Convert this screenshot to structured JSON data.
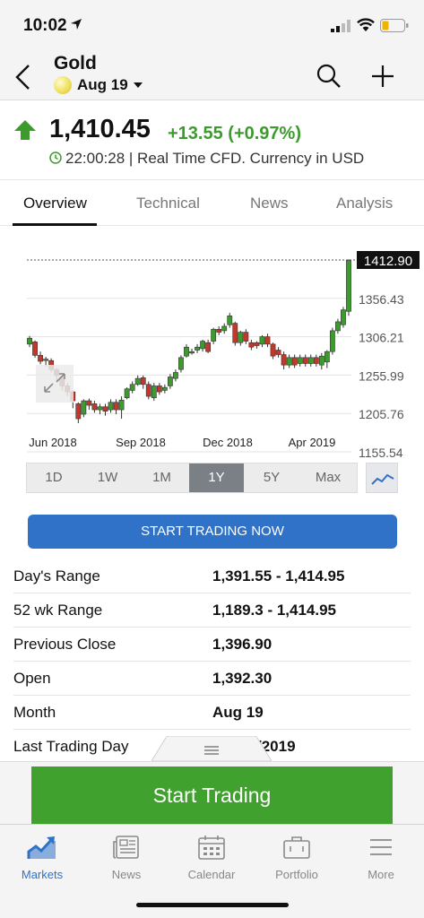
{
  "status": {
    "time": "10:02"
  },
  "header": {
    "title": "Gold",
    "contract": "Aug 19"
  },
  "quote": {
    "price": "1,410.45",
    "change": "+13.55 (+0.97%)",
    "time_text": "22:00:28 | Real Time CFD. Currency in USD",
    "change_color": "#3d9b2e"
  },
  "tabs": [
    "Overview",
    "Technical",
    "News",
    "Analysis"
  ],
  "active_tab": "Overview",
  "chart_data": {
    "type": "candlestick",
    "x_ticks": [
      "Jun 2018",
      "Sep 2018",
      "Dec 2018",
      "Apr 2019"
    ],
    "y_ticks": [
      "1412.90",
      "1356.43",
      "1306.21",
      "1255.99",
      "1205.76",
      "1155.54"
    ],
    "last_price_label": "1412.90",
    "up_color": "#3d9b2e",
    "down_color": "#c0392b",
    "ylim": [
      1155.54,
      1412.9
    ],
    "candles": [
      {
        "o": 1300,
        "c": 1308,
        "h": 1311,
        "l": 1296
      },
      {
        "o": 1303,
        "c": 1285,
        "h": 1305,
        "l": 1282
      },
      {
        "o": 1285,
        "c": 1277,
        "h": 1290,
        "l": 1273
      },
      {
        "o": 1278,
        "c": 1280,
        "h": 1283,
        "l": 1270
      },
      {
        "o": 1278,
        "c": 1266,
        "h": 1281,
        "l": 1262
      },
      {
        "o": 1266,
        "c": 1258,
        "h": 1268,
        "l": 1250
      },
      {
        "o": 1256,
        "c": 1244,
        "h": 1258,
        "l": 1238
      },
      {
        "o": 1244,
        "c": 1236,
        "h": 1248,
        "l": 1230
      },
      {
        "o": 1236,
        "c": 1224,
        "h": 1238,
        "l": 1214
      },
      {
        "o": 1220,
        "c": 1200,
        "h": 1222,
        "l": 1194
      },
      {
        "o": 1206,
        "c": 1224,
        "h": 1226,
        "l": 1202
      },
      {
        "o": 1224,
        "c": 1218,
        "h": 1227,
        "l": 1212
      },
      {
        "o": 1220,
        "c": 1212,
        "h": 1224,
        "l": 1208
      },
      {
        "o": 1212,
        "c": 1216,
        "h": 1220,
        "l": 1206
      },
      {
        "o": 1216,
        "c": 1210,
        "h": 1220,
        "l": 1204
      },
      {
        "o": 1212,
        "c": 1222,
        "h": 1226,
        "l": 1208
      },
      {
        "o": 1222,
        "c": 1212,
        "h": 1226,
        "l": 1206
      },
      {
        "o": 1212,
        "c": 1225,
        "h": 1230,
        "l": 1200
      },
      {
        "o": 1228,
        "c": 1240,
        "h": 1242,
        "l": 1226
      },
      {
        "o": 1238,
        "c": 1246,
        "h": 1250,
        "l": 1234
      },
      {
        "o": 1246,
        "c": 1254,
        "h": 1258,
        "l": 1244
      },
      {
        "o": 1255,
        "c": 1246,
        "h": 1258,
        "l": 1240
      },
      {
        "o": 1246,
        "c": 1230,
        "h": 1250,
        "l": 1226
      },
      {
        "o": 1228,
        "c": 1244,
        "h": 1248,
        "l": 1224
      },
      {
        "o": 1244,
        "c": 1236,
        "h": 1248,
        "l": 1232
      },
      {
        "o": 1238,
        "c": 1242,
        "h": 1246,
        "l": 1234
      },
      {
        "o": 1244,
        "c": 1256,
        "h": 1260,
        "l": 1240
      },
      {
        "o": 1254,
        "c": 1262,
        "h": 1266,
        "l": 1250
      },
      {
        "o": 1266,
        "c": 1282,
        "h": 1285,
        "l": 1262
      },
      {
        "o": 1284,
        "c": 1296,
        "h": 1300,
        "l": 1282
      },
      {
        "o": 1288,
        "c": 1290,
        "h": 1294,
        "l": 1286
      },
      {
        "o": 1292,
        "c": 1296,
        "h": 1300,
        "l": 1288
      },
      {
        "o": 1294,
        "c": 1304,
        "h": 1306,
        "l": 1290
      },
      {
        "o": 1302,
        "c": 1290,
        "h": 1306,
        "l": 1288
      },
      {
        "o": 1304,
        "c": 1320,
        "h": 1322,
        "l": 1300
      },
      {
        "o": 1320,
        "c": 1316,
        "h": 1324,
        "l": 1312
      },
      {
        "o": 1318,
        "c": 1324,
        "h": 1328,
        "l": 1314
      },
      {
        "o": 1326,
        "c": 1338,
        "h": 1342,
        "l": 1322
      },
      {
        "o": 1328,
        "c": 1302,
        "h": 1330,
        "l": 1298
      },
      {
        "o": 1302,
        "c": 1316,
        "h": 1318,
        "l": 1298
      },
      {
        "o": 1316,
        "c": 1304,
        "h": 1320,
        "l": 1300
      },
      {
        "o": 1302,
        "c": 1296,
        "h": 1306,
        "l": 1292
      },
      {
        "o": 1302,
        "c": 1298,
        "h": 1304,
        "l": 1294
      },
      {
        "o": 1300,
        "c": 1310,
        "h": 1312,
        "l": 1296
      },
      {
        "o": 1310,
        "c": 1300,
        "h": 1314,
        "l": 1296
      },
      {
        "o": 1300,
        "c": 1284,
        "h": 1302,
        "l": 1280
      },
      {
        "o": 1292,
        "c": 1286,
        "h": 1296,
        "l": 1282
      },
      {
        "o": 1286,
        "c": 1272,
        "h": 1290,
        "l": 1266
      },
      {
        "o": 1272,
        "c": 1282,
        "h": 1286,
        "l": 1268
      },
      {
        "o": 1282,
        "c": 1272,
        "h": 1286,
        "l": 1268
      },
      {
        "o": 1274,
        "c": 1282,
        "h": 1286,
        "l": 1270
      },
      {
        "o": 1282,
        "c": 1274,
        "h": 1286,
        "l": 1270
      },
      {
        "o": 1274,
        "c": 1282,
        "h": 1286,
        "l": 1270
      },
      {
        "o": 1282,
        "c": 1274,
        "h": 1286,
        "l": 1270
      },
      {
        "o": 1272,
        "c": 1284,
        "h": 1288,
        "l": 1266
      },
      {
        "o": 1276,
        "c": 1290,
        "h": 1292,
        "l": 1268
      },
      {
        "o": 1290,
        "c": 1318,
        "h": 1322,
        "l": 1286
      },
      {
        "o": 1318,
        "c": 1330,
        "h": 1334,
        "l": 1314
      },
      {
        "o": 1326,
        "c": 1346,
        "h": 1350,
        "l": 1322
      },
      {
        "o": 1344,
        "c": 1412,
        "h": 1414,
        "l": 1338
      }
    ]
  },
  "ranges": [
    "1D",
    "1W",
    "1M",
    "1Y",
    "5Y",
    "Max"
  ],
  "active_range": "1Y",
  "trade_now_label": "START TRADING NOW",
  "stats": [
    {
      "label": "Day's Range",
      "value": "1,391.55 - 1,414.95"
    },
    {
      "label": "52 wk Range",
      "value": "1,189.3 - 1,414.95"
    },
    {
      "label": "Previous Close",
      "value": "1,396.90"
    },
    {
      "label": "Open",
      "value": "1,392.30"
    },
    {
      "label": "Month",
      "value": "Aug 19"
    },
    {
      "label": "Last Trading Day",
      "value": "/2019"
    }
  ],
  "start_trading_label": "Start Trading",
  "tabbar": [
    {
      "label": "Markets",
      "icon": "markets-icon"
    },
    {
      "label": "News",
      "icon": "news-icon"
    },
    {
      "label": "Calendar",
      "icon": "calendar-icon"
    },
    {
      "label": "Portfolio",
      "icon": "portfolio-icon"
    },
    {
      "label": "More",
      "icon": "more-icon"
    }
  ],
  "colors": {
    "accent": "#2f72c8",
    "positive": "#3d9b2e",
    "negative": "#c0392b",
    "cta": "#41a12e"
  }
}
